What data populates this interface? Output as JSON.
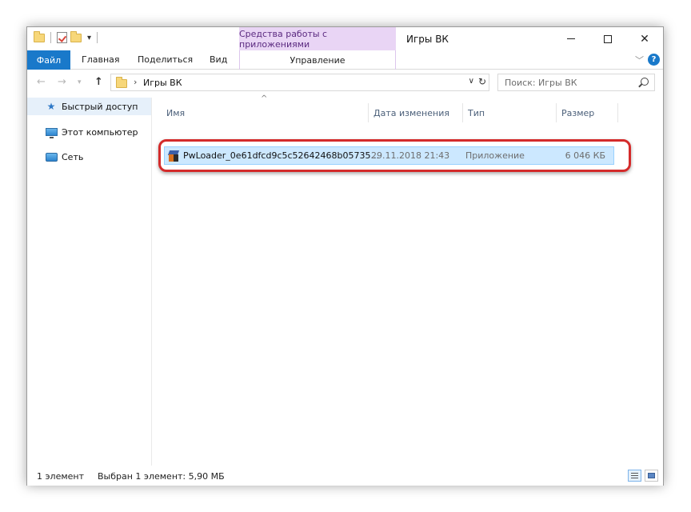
{
  "titlebar": {
    "context_tab": "Средства работы с приложениями",
    "window_title": "Игры ВК",
    "minimize": "—",
    "maximize": "☐",
    "close": "✕"
  },
  "ribbon": {
    "tabs": [
      "Файл",
      "Главная",
      "Поделиться",
      "Вид"
    ],
    "context_sub": "Управление",
    "help": "?"
  },
  "address": {
    "path": "Игры ВК",
    "search_placeholder": "Поиск: Игры ВК"
  },
  "nav_pane": {
    "items": [
      {
        "label": "Быстрый доступ",
        "icon": "star-icon"
      },
      {
        "label": "Этот компьютер",
        "icon": "computer-icon"
      },
      {
        "label": "Сеть",
        "icon": "network-icon"
      }
    ]
  },
  "columns": [
    "Имя",
    "Дата изменения",
    "Тип",
    "Размер"
  ],
  "files": [
    {
      "name": "PwLoader_0e61dfcd9c5c52642468b05735...",
      "date": "29.11.2018 21:43",
      "type": "Приложение",
      "size": "6 046 КБ"
    }
  ],
  "status": {
    "count": "1 элемент",
    "selection": "Выбран 1 элемент: 5,90 МБ"
  },
  "colors": {
    "file_tab": "#1979ca",
    "context_tab": "#e9d5f5",
    "selection": "#cce8ff",
    "highlight_border": "#d42b2b"
  }
}
